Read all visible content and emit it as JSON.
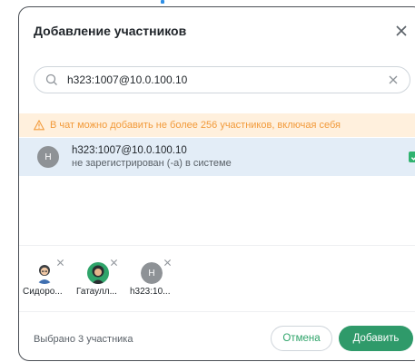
{
  "dialog": {
    "title": "Добавление участников",
    "close_icon": "close-icon"
  },
  "search": {
    "value": "h323:1007@10.0.100.10",
    "search_icon": "search-icon",
    "clear_icon": "clear-icon"
  },
  "warning": {
    "icon": "warning-icon",
    "text": "В чат можно добавить не более 256 участников, включая себя"
  },
  "result": {
    "avatar_letter": "H",
    "name": "h323:1007@10.0.100.10",
    "status": "не зарегистрирован (-а) в системе",
    "checked": true
  },
  "selected": [
    {
      "label": "Сидоро...",
      "avatar": "woman-avatar-icon"
    },
    {
      "label": "Гатаулл...",
      "avatar": "woman-avatar-icon"
    },
    {
      "label": "h323:10...",
      "avatar_letter": "H"
    }
  ],
  "footer": {
    "selected_count": "Выбрано 3 участника",
    "cancel_label": "Отмена",
    "add_label": "Добавить"
  },
  "colors": {
    "accent": "#2f9a6a",
    "warning": "#f29a3a",
    "row_highlight": "#e3edf7"
  }
}
